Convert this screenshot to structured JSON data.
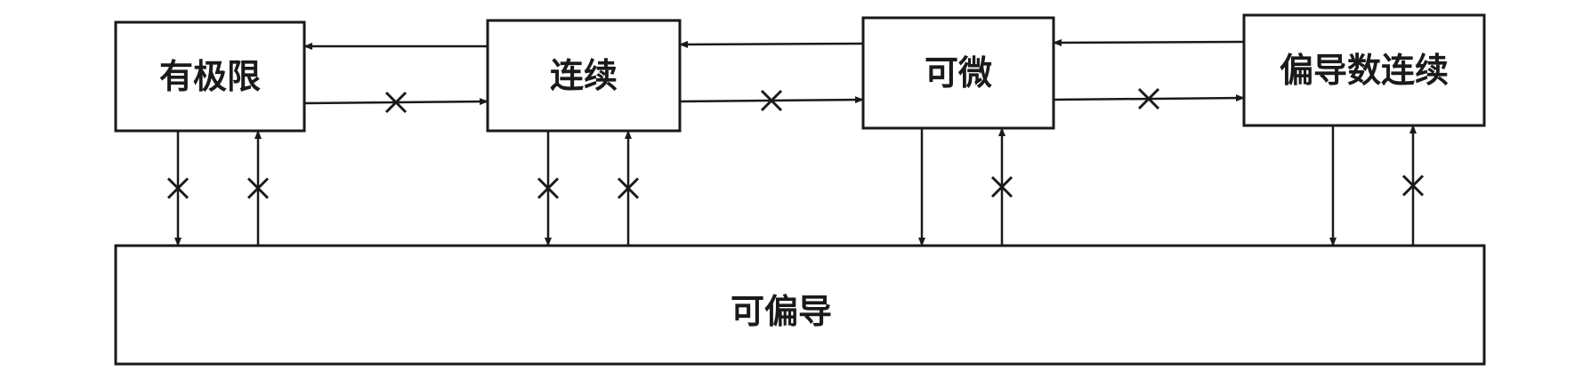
{
  "nodes": [
    {
      "id": "bounded-limit",
      "label": "有极限"
    },
    {
      "id": "continuous",
      "label": "连续"
    },
    {
      "id": "differentiable",
      "label": "可微"
    },
    {
      "id": "continuous-partials",
      "label": "偏导数连续"
    },
    {
      "id": "partially-differentiable",
      "label": "可偏导"
    }
  ],
  "edges": [
    {
      "from": "continuous",
      "to": "bounded-limit",
      "crossed": false
    },
    {
      "from": "bounded-limit",
      "to": "continuous",
      "crossed": true
    },
    {
      "from": "differentiable",
      "to": "continuous",
      "crossed": false
    },
    {
      "from": "continuous",
      "to": "differentiable",
      "crossed": true
    },
    {
      "from": "continuous-partials",
      "to": "differentiable",
      "crossed": false
    },
    {
      "from": "differentiable",
      "to": "continuous-partials",
      "crossed": true
    },
    {
      "from": "bounded-limit",
      "to": "partially-differentiable",
      "crossed": true
    },
    {
      "from": "partially-differentiable",
      "to": "bounded-limit",
      "crossed": true
    },
    {
      "from": "continuous",
      "to": "partially-differentiable",
      "crossed": true
    },
    {
      "from": "partially-differentiable",
      "to": "continuous",
      "crossed": true
    },
    {
      "from": "differentiable",
      "to": "partially-differentiable",
      "crossed": false
    },
    {
      "from": "partially-differentiable",
      "to": "differentiable",
      "crossed": true
    },
    {
      "from": "continuous-partials",
      "to": "partially-differentiable",
      "crossed": false
    },
    {
      "from": "partially-differentiable",
      "to": "continuous-partials",
      "crossed": true
    }
  ]
}
